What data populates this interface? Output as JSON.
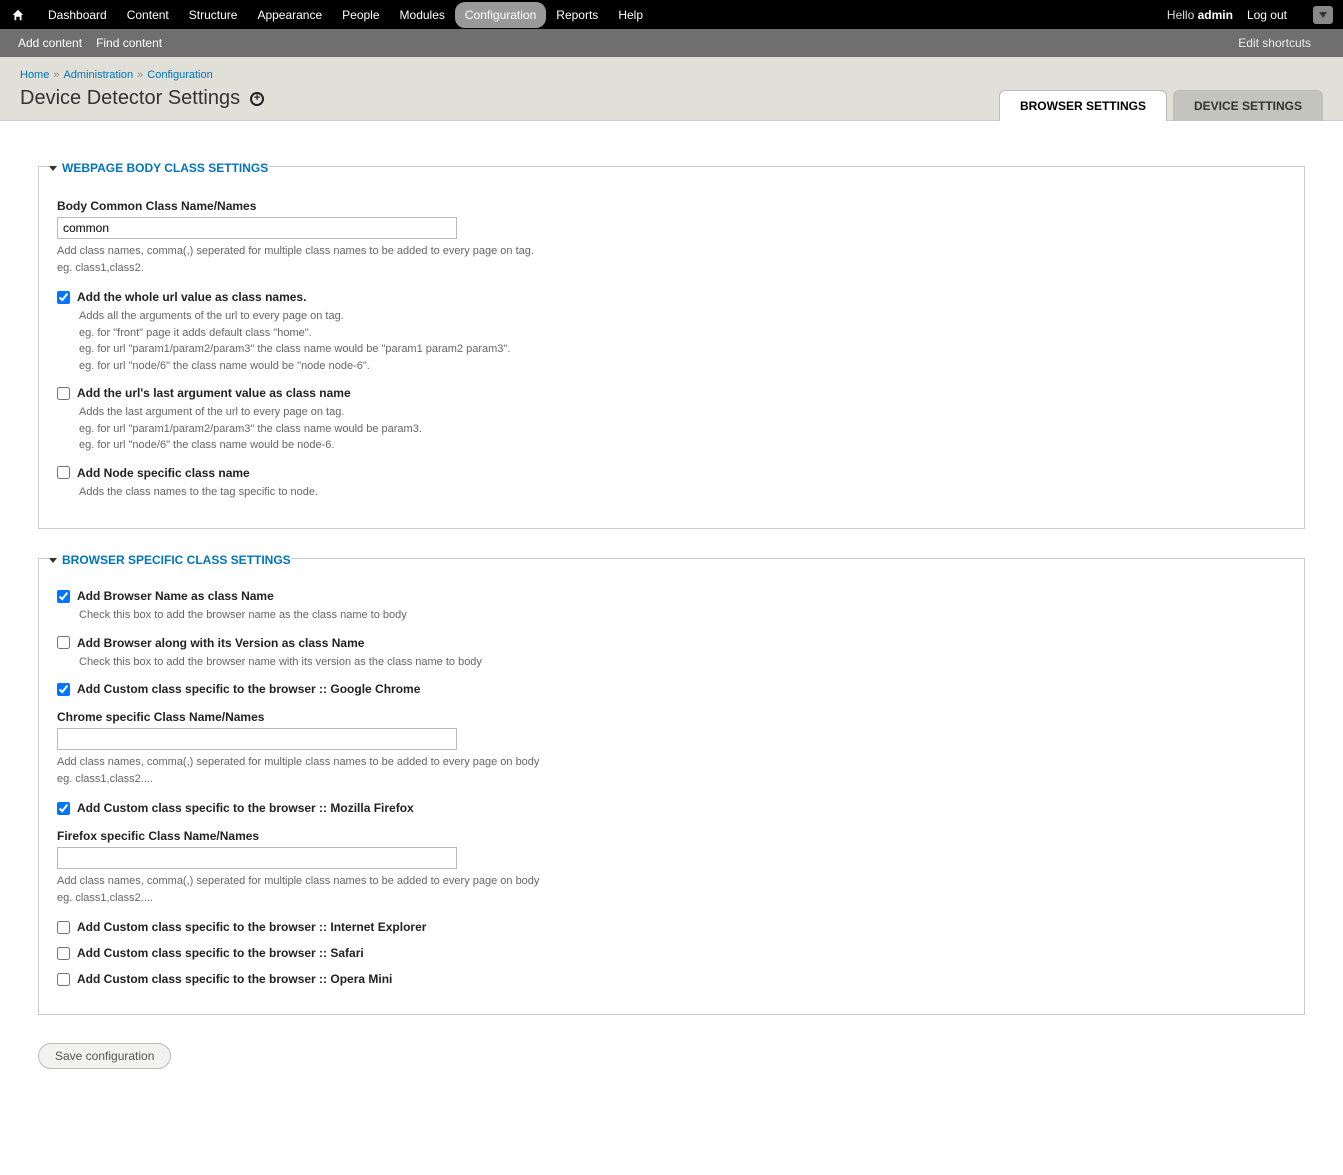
{
  "toolbar": {
    "menu": [
      "Dashboard",
      "Content",
      "Structure",
      "Appearance",
      "People",
      "Modules",
      "Configuration",
      "Reports",
      "Help"
    ],
    "active_index": 6,
    "hello_prefix": "Hello ",
    "user": "admin",
    "logout": "Log out"
  },
  "shortcut": {
    "links": [
      "Add content",
      "Find content"
    ],
    "edit": "Edit shortcuts"
  },
  "breadcrumb": {
    "items": [
      "Home",
      "Administration",
      "Configuration"
    ]
  },
  "page_title": "Device Detector Settings",
  "tabs": {
    "items": [
      "BROWSER SETTINGS",
      "DEVICE SETTINGS"
    ],
    "active_index": 0
  },
  "panel1": {
    "legend": "WEBPAGE BODY CLASS SETTINGS",
    "body_class": {
      "label": "Body Common Class Name/Names",
      "value": "common",
      "desc": "Add class names, comma(,) seperated for multiple class names to be added to every page on tag.\neg. class1,class2."
    },
    "chk_whole_url": {
      "label": "Add the whole url value as class names.",
      "checked": true,
      "desc": "Adds all the arguments of the url to every page on tag.\neg. for \"front\" page it adds default class \"home\".\neg. for url \"param1/param2/param3\" the class name would be \"param1 param2 param3\".\neg. for url \"node/6\" the class name would be \"node node-6\"."
    },
    "chk_last_arg": {
      "label": "Add the url's last argument value as class name",
      "checked": false,
      "desc": "Adds the last argument of the url to every page on tag.\neg. for url \"param1/param2/param3\" the class name would be param3.\neg. for url \"node/6\" the class name would be node-6."
    },
    "chk_node": {
      "label": "Add Node specific class name",
      "checked": false,
      "desc": "Adds the class names to the tag specific to node."
    }
  },
  "panel2": {
    "legend": "BROWSER SPECIFIC CLASS SETTINGS",
    "chk_browser_name": {
      "label": "Add Browser Name as class Name",
      "checked": true,
      "desc": "Check this box to add the browser name as the class name to body"
    },
    "chk_browser_version": {
      "label": "Add Browser along with its Version as class Name",
      "checked": false,
      "desc": "Check this box to add the browser name with its version as the class name to body"
    },
    "chk_chrome": {
      "label": "Add Custom class specific to the browser :: Google Chrome",
      "checked": true
    },
    "chrome_class": {
      "label": "Chrome specific Class Name/Names",
      "value": "",
      "desc": "Add class names, comma(,) seperated for multiple class names to be added to every page on body\neg. class1,class2...."
    },
    "chk_firefox": {
      "label": "Add Custom class specific to the browser :: Mozilla Firefox",
      "checked": true
    },
    "firefox_class": {
      "label": "Firefox specific Class Name/Names",
      "value": "",
      "desc": "Add class names, comma(,) seperated for multiple class names to be added to every page on body\neg. class1,class2...."
    },
    "chk_ie": {
      "label": "Add Custom class specific to the browser :: Internet Explorer",
      "checked": false
    },
    "chk_safari": {
      "label": "Add Custom class specific to the browser :: Safari",
      "checked": false
    },
    "chk_opera": {
      "label": "Add Custom class specific to the browser :: Opera Mini",
      "checked": false
    }
  },
  "save_label": "Save configuration"
}
